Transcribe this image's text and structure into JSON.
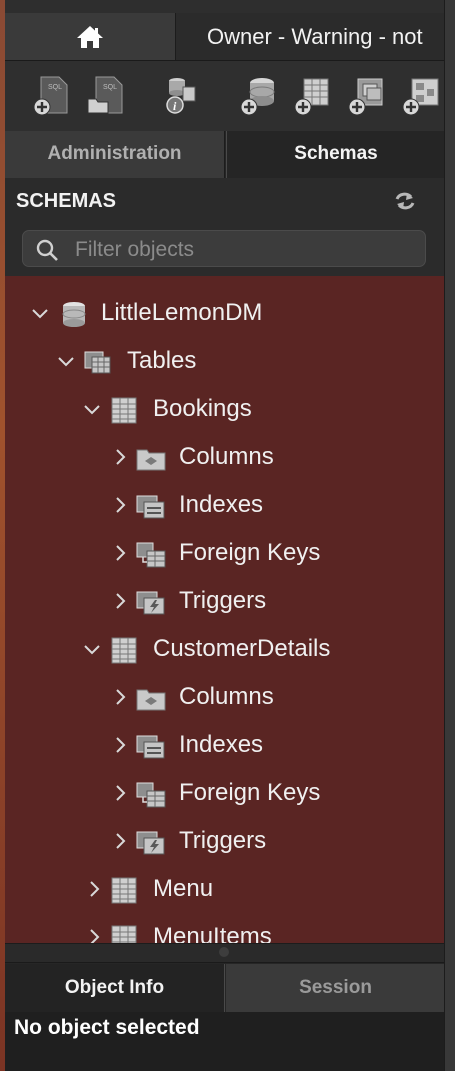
{
  "tabs": {
    "home_icon": "home-icon",
    "document_tab": "Owner - Warning - not"
  },
  "toolbar": {
    "icons": [
      "new-sql-tab-icon",
      "open-sql-script-icon",
      "inspect-icon",
      "create-schema-icon",
      "create-table-icon",
      "create-view-icon",
      "create-procedure-icon"
    ]
  },
  "navigator_tabs": {
    "administration": "Administration",
    "schemas": "Schemas"
  },
  "schemas_panel": {
    "title": "SCHEMAS",
    "filter_placeholder": "Filter objects"
  },
  "tree": {
    "schema": "LittleLemonDM",
    "tables_label": "Tables",
    "tables": [
      {
        "name": "Bookings",
        "children": [
          "Columns",
          "Indexes",
          "Foreign Keys",
          "Triggers"
        ]
      },
      {
        "name": "CustomerDetails",
        "children": [
          "Columns",
          "Indexes",
          "Foreign Keys",
          "Triggers"
        ]
      },
      {
        "name": "Menu"
      },
      {
        "name": "MenuItems"
      }
    ]
  },
  "bottom_tabs": {
    "object_info": "Object Info",
    "session": "Session"
  },
  "object_info": {
    "message": "No object selected"
  },
  "colors": {
    "tree_background": "#5a2523",
    "panel_background": "#2b2b2b"
  }
}
